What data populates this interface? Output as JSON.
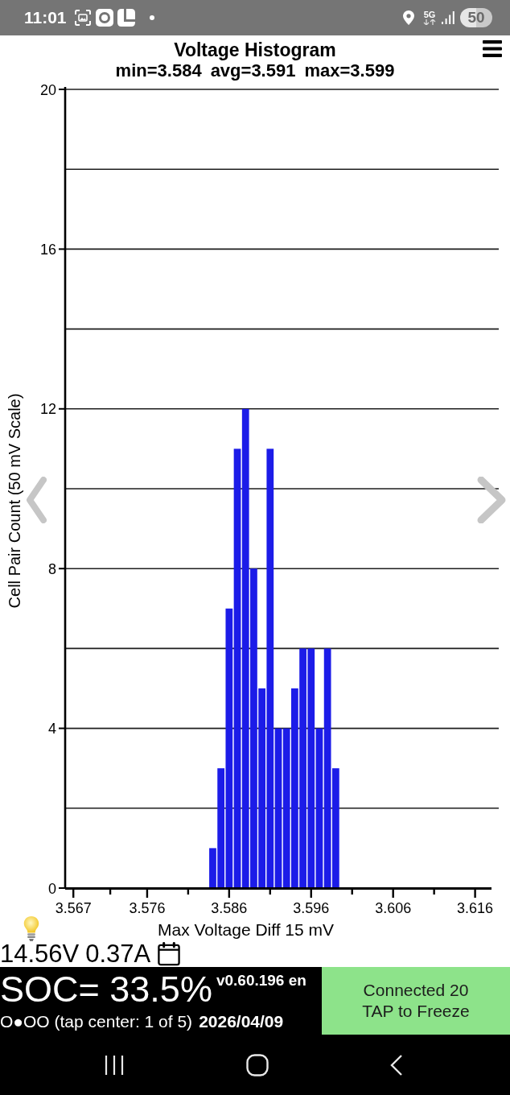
{
  "status_bar": {
    "time": "11:01",
    "network": "5G",
    "battery": "50"
  },
  "histogram": {
    "stats": [
      "min=3.584",
      "avg=3.591",
      "max=3.599"
    ],
    "chart_data": {
      "type": "bar",
      "title": "Voltage Histogram",
      "xlabel": "Max Voltage Diff 15 mV",
      "ylabel": "Cell Pair Count (50 mV Scale)",
      "x": [
        3.584,
        3.585,
        3.586,
        3.587,
        3.588,
        3.589,
        3.59,
        3.591,
        3.592,
        3.593,
        3.594,
        3.595,
        3.596,
        3.597,
        3.598,
        3.599
      ],
      "values": [
        1,
        3,
        7,
        11,
        12,
        8,
        5,
        11,
        4,
        4,
        5,
        6,
        6,
        4,
        6,
        3
      ],
      "xlim": [
        3.566,
        3.618
      ],
      "ylim": [
        0,
        20
      ],
      "xticks": [
        3.567,
        3.576,
        3.586,
        3.596,
        3.606,
        3.616
      ],
      "yticks": [
        0,
        4,
        8,
        12,
        16,
        20
      ],
      "grid": true
    }
  },
  "readings": {
    "voltage": "14.56V",
    "current": "0.37A"
  },
  "bottom_panel": {
    "soc": "SOC= 33.5%",
    "version": "v0.60.196 en",
    "page_indicator": "O●OO (tap center: 1 of 5)",
    "date": "2026/04/09",
    "connection_button": [
      "Connected 20",
      "TAP to Freeze"
    ]
  }
}
